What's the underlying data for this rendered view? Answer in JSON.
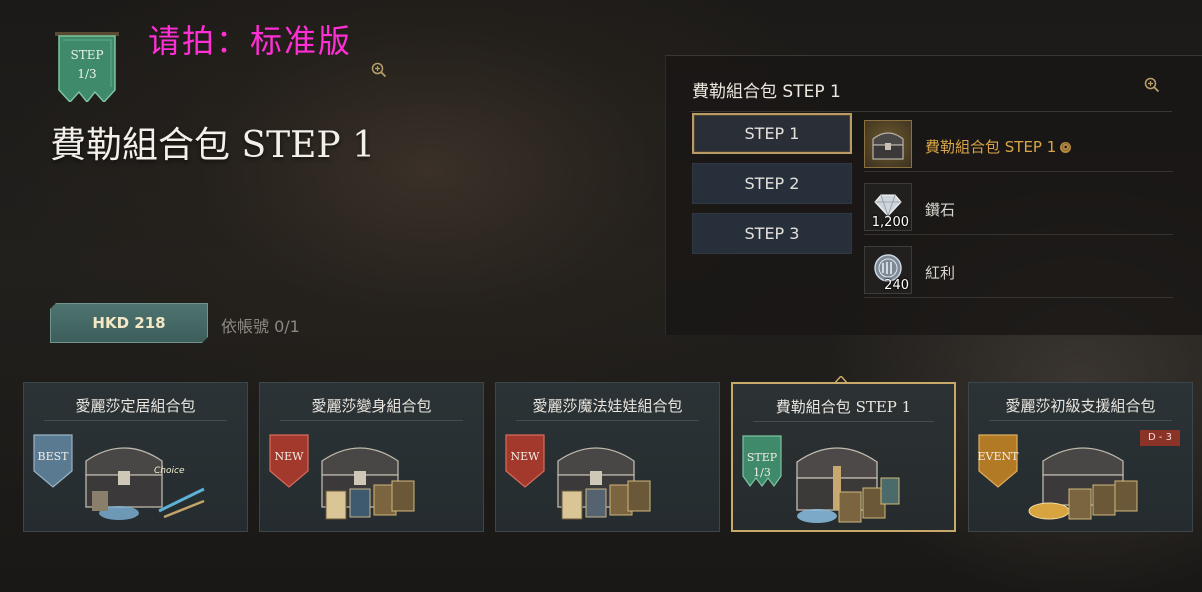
{
  "watermark": "请拍：标准版",
  "header": {
    "banner": {
      "line1": "STEP",
      "line2": "1/3",
      "color": "#3f8a6a"
    },
    "title": "費勒組合包 STEP 1"
  },
  "purchase": {
    "price": "HKD 218",
    "limit": "依帳號 0/1"
  },
  "panel": {
    "title": "費勒組合包 STEP 1",
    "tabs": [
      {
        "label": "STEP 1",
        "active": true
      },
      {
        "label": "STEP 2",
        "active": false
      },
      {
        "label": "STEP 3",
        "active": false
      }
    ],
    "items": [
      {
        "name": "費勒組合包 STEP 1",
        "qty": "",
        "icon": "chest-icon",
        "highlight": true
      },
      {
        "name": "鑽石",
        "qty": "1,200",
        "icon": "diamond-icon",
        "highlight": false
      },
      {
        "name": "紅利",
        "qty": "240",
        "icon": "bonus-coin-icon",
        "highlight": false
      }
    ]
  },
  "cards": [
    {
      "title": "愛麗莎定居組合包",
      "flag": "BEST",
      "flag_line2": "",
      "flag_color": "#5a7a92",
      "choice": "Choice",
      "dday": ""
    },
    {
      "title": "愛麗莎變身組合包",
      "flag": "NEW",
      "flag_line2": "",
      "flag_color": "#a2392c",
      "choice": "",
      "dday": ""
    },
    {
      "title": "愛麗莎魔法娃娃組合包",
      "flag": "NEW",
      "flag_line2": "",
      "flag_color": "#a2392c",
      "choice": "",
      "dday": ""
    },
    {
      "title": "費勒組合包 STEP 1",
      "flag": "STEP",
      "flag_line2": "1/3",
      "flag_color": "#3f8a6a",
      "choice": "",
      "dday": ""
    },
    {
      "title": "愛麗莎初級支援組合包",
      "flag": "EVENT",
      "flag_line2": "",
      "flag_color": "#b37a26",
      "choice": "",
      "dday": "D - 3"
    }
  ],
  "colors": {
    "accent_gold": "#c9a96a",
    "price_teal": "#4e7470",
    "item_gold_text": "#d9a548"
  }
}
